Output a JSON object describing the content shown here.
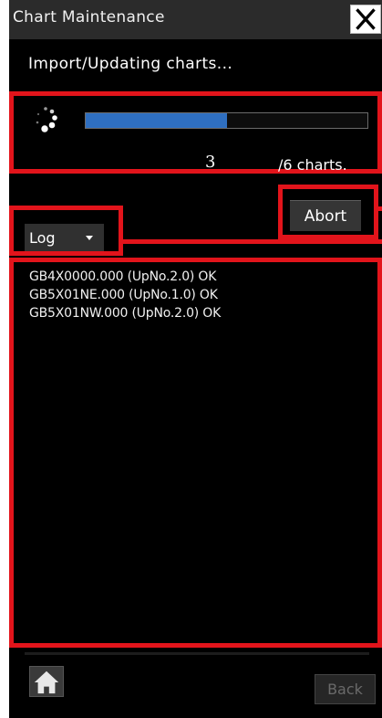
{
  "window": {
    "title": "Chart Maintenance",
    "close_icon": "close-x-icon"
  },
  "status": {
    "message": "Import/Updating charts..."
  },
  "progress": {
    "spinner_icon": "loading-spinner-icon",
    "fraction": 0.5,
    "current": "3",
    "total_label": "/6 charts."
  },
  "controls": {
    "abort_label": "Abort",
    "view_select_value": "Log",
    "view_select_icon": "caret-down-icon"
  },
  "log": {
    "entries": [
      "GB4X0000.000 (UpNo.2.0) OK",
      "GB5X01NE.000 (UpNo.1.0) OK",
      "GB5X01NW.000 (UpNo.2.0) OK"
    ]
  },
  "footer": {
    "home_icon": "home-icon",
    "back_label": "Back"
  },
  "colors": {
    "highlight": "#e2141b",
    "progress_fill": "#2f6fc0",
    "background": "#000000"
  }
}
